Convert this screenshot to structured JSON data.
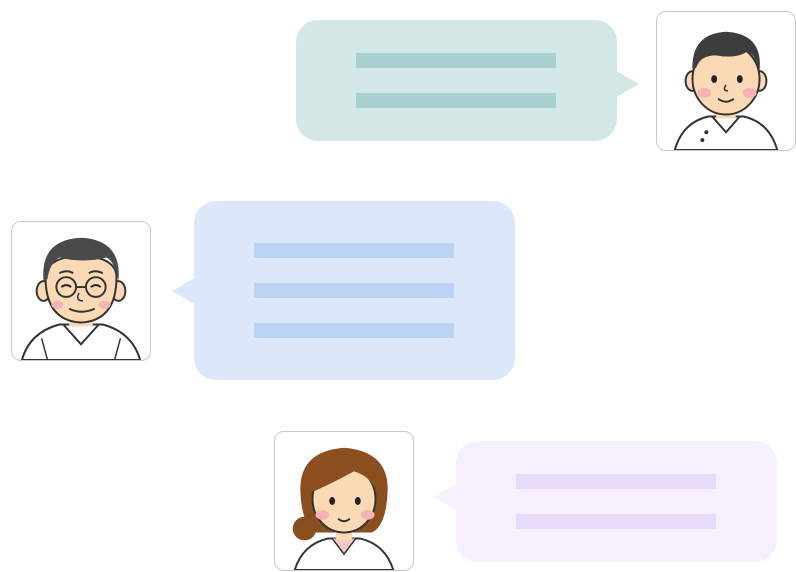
{
  "colors": {
    "bubble_teal": "#d3e7e7",
    "line_teal": "#a9d0d0",
    "bubble_blue": "#dce8fa",
    "line_blue": "#bcd4f4",
    "bubble_lavender": "#f6f0fe",
    "line_lavender": "#e8dcfa",
    "avatar_border": "#c9c9c9"
  },
  "messages": [
    {
      "speaker": "male-doctor",
      "avatar_icon": "young-male-doctor-icon",
      "side": "right",
      "placeholder_lines": 2,
      "color": "teal"
    },
    {
      "speaker": "senior-doctor",
      "avatar_icon": "senior-male-doctor-with-glasses-icon",
      "side": "left",
      "placeholder_lines": 3,
      "color": "blue"
    },
    {
      "speaker": "female-doctor",
      "avatar_icon": "female-doctor-icon",
      "side": "left",
      "placeholder_lines": 2,
      "color": "lavender"
    }
  ]
}
